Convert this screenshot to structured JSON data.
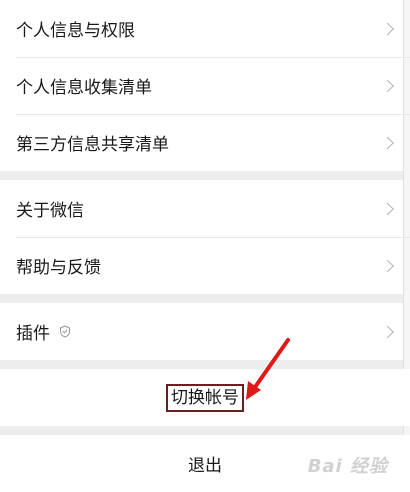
{
  "settings": {
    "group1": [
      {
        "label": "个人信息与权限"
      },
      {
        "label": "个人信息收集清单"
      },
      {
        "label": "第三方信息共享清单"
      }
    ],
    "group2": [
      {
        "label": "关于微信"
      },
      {
        "label": "帮助与反馈"
      }
    ],
    "group3": [
      {
        "label": "插件",
        "icon": "plugin-shield-icon"
      }
    ],
    "switch_account": "切换帐号",
    "logout": "退出"
  },
  "annotation": {
    "arrow_color": "#e01818",
    "box_color": "#6b1f1f"
  },
  "watermark": {
    "text": "Bai 经验"
  }
}
